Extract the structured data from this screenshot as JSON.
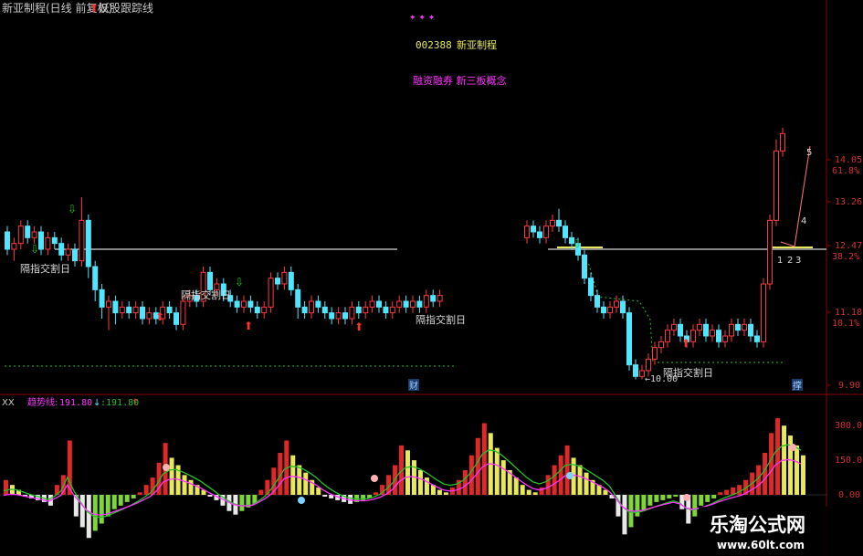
{
  "header": {
    "title": "新亚制程(日线 前复权)",
    "indicator": "妖股跟踪线",
    "stock_code": "002388",
    "stock_name": "新亚制程",
    "concepts": "融资融券 新三板概念",
    "stars": "✦ ✦ ✦"
  },
  "price_axis": {
    "labels": [
      "14.05",
      "61.8%",
      "13.26",
      "12.47",
      "38.2%",
      "11.18",
      "10.1%",
      "9.90"
    ]
  },
  "macd_axis": {
    "labels": [
      "300.0",
      "150.0",
      "0.00"
    ]
  },
  "lower_header": {
    "xx": "XX",
    "name": "趋势线:",
    "value1": "191.80",
    "value2": ":191.80"
  },
  "annotations": {
    "cross_label": "隔指交割日",
    "low_price": "10.00",
    "wave_labels": [
      "1",
      "2",
      "3",
      "4",
      "5"
    ],
    "fin_tag": "财",
    "jin_tag": "撑"
  },
  "watermark": {
    "line1": "乐淘公式网",
    "line2": "www.60lt.com"
  },
  "colors": {
    "up": "#ff3a3a",
    "down": "#4fe6ff",
    "ma": "#d8d8d8",
    "yellow": "#e8e85a",
    "green_dots": "#25c025",
    "magenta": "#ff33ff"
  },
  "chart_data": {
    "type": "candlestick",
    "price_range": [
      9.8,
      14.3
    ],
    "candles_segment1": [
      [
        12.5,
        12.2,
        12.6,
        12.1
      ],
      [
        12.2,
        12.3,
        12.4,
        12.0
      ],
      [
        12.3,
        12.6,
        12.7,
        12.2
      ],
      [
        12.6,
        12.4,
        12.7,
        12.3
      ],
      [
        12.4,
        12.5,
        12.6,
        12.3
      ],
      [
        12.5,
        12.2,
        12.6,
        12.1
      ],
      [
        12.2,
        12.4,
        12.5,
        12.1
      ],
      [
        12.4,
        12.3,
        12.5,
        12.2
      ],
      [
        12.3,
        12.1,
        12.4,
        12.0
      ],
      [
        12.1,
        12.2,
        12.3,
        12.0
      ],
      [
        12.2,
        12.0,
        12.3,
        11.9
      ],
      [
        12.0,
        12.7,
        13.1,
        11.9
      ],
      [
        12.7,
        11.9,
        12.8,
        11.7
      ],
      [
        11.9,
        11.5,
        12.0,
        11.3
      ],
      [
        11.5,
        11.2,
        11.6,
        11.0
      ],
      [
        11.2,
        11.3,
        11.4,
        10.8
      ],
      [
        11.3,
        11.1,
        11.4,
        10.9
      ],
      [
        11.1,
        11.2,
        11.3,
        11.0
      ],
      [
        11.2,
        11.1,
        11.3,
        11.0
      ],
      [
        11.1,
        11.2,
        11.3,
        11.0
      ],
      [
        11.2,
        11.0,
        11.3,
        10.9
      ],
      [
        11.0,
        11.1,
        11.2,
        10.9
      ],
      [
        11.1,
        11.0,
        11.2,
        10.9
      ],
      [
        11.0,
        11.2,
        11.3,
        10.9
      ],
      [
        11.2,
        11.1,
        11.3,
        11.0
      ],
      [
        11.1,
        10.9,
        11.2,
        10.8
      ],
      [
        10.9,
        11.3,
        11.4,
        10.8
      ],
      [
        11.3,
        11.4,
        11.5,
        11.2
      ],
      [
        11.4,
        11.3,
        11.5,
        11.2
      ],
      [
        11.3,
        11.8,
        11.9,
        11.2
      ],
      [
        11.8,
        11.5,
        11.9,
        11.4
      ],
      [
        11.5,
        11.6,
        11.7,
        11.4
      ],
      [
        11.6,
        11.4,
        11.7,
        11.3
      ],
      [
        11.4,
        11.3,
        11.5,
        11.2
      ],
      [
        11.3,
        11.2,
        11.4,
        11.1
      ],
      [
        11.2,
        11.3,
        11.4,
        11.1
      ],
      [
        11.3,
        11.2,
        11.4,
        11.1
      ],
      [
        11.2,
        11.1,
        11.3,
        11.0
      ],
      [
        11.1,
        11.2,
        11.3,
        11.0
      ],
      [
        11.2,
        11.7,
        11.8,
        11.1
      ],
      [
        11.7,
        11.6,
        11.8,
        11.5
      ],
      [
        11.6,
        11.8,
        11.9,
        11.5
      ],
      [
        11.8,
        11.5,
        11.9,
        11.4
      ],
      [
        11.5,
        11.2,
        11.6,
        11.0
      ],
      [
        11.2,
        11.1,
        11.3,
        11.0
      ],
      [
        11.1,
        11.3,
        11.4,
        11.0
      ],
      [
        11.3,
        11.2,
        11.4,
        11.1
      ],
      [
        11.2,
        11.1,
        11.3,
        11.0
      ],
      [
        11.1,
        11.0,
        11.2,
        10.9
      ],
      [
        11.0,
        11.1,
        11.2,
        10.9
      ],
      [
        11.1,
        11.0,
        11.2,
        10.9
      ],
      [
        11.0,
        11.2,
        11.3,
        10.9
      ],
      [
        11.2,
        11.1,
        11.3,
        11.0
      ],
      [
        11.1,
        11.2,
        11.3,
        11.0
      ],
      [
        11.2,
        11.3,
        11.4,
        11.1
      ],
      [
        11.3,
        11.2,
        11.4,
        11.1
      ],
      [
        11.2,
        11.1,
        11.3,
        11.0
      ],
      [
        11.1,
        11.2,
        11.3,
        11.0
      ],
      [
        11.2,
        11.3,
        11.4,
        11.1
      ],
      [
        11.3,
        11.2,
        11.4,
        11.1
      ],
      [
        11.2,
        11.3,
        11.4,
        11.1
      ],
      [
        11.3,
        11.2,
        11.4,
        11.1
      ],
      [
        11.2,
        11.4,
        11.5,
        11.1
      ],
      [
        11.4,
        11.3,
        11.5,
        11.2
      ],
      [
        11.3,
        11.4,
        11.5,
        11.2
      ]
    ],
    "candles_segment2": [
      [
        12.4,
        12.6,
        12.7,
        12.3
      ],
      [
        12.6,
        12.5,
        12.7,
        12.4
      ],
      [
        12.5,
        12.4,
        12.6,
        12.3
      ],
      [
        12.4,
        12.6,
        12.7,
        12.3
      ],
      [
        12.6,
        12.7,
        12.8,
        12.5
      ],
      [
        12.7,
        12.6,
        12.9,
        12.5
      ],
      [
        12.6,
        12.4,
        12.7,
        12.3
      ],
      [
        12.4,
        12.3,
        12.5,
        12.2
      ],
      [
        12.3,
        12.1,
        12.4,
        12.0
      ],
      [
        12.1,
        11.7,
        12.2,
        11.6
      ],
      [
        11.7,
        11.4,
        11.8,
        11.3
      ],
      [
        11.4,
        11.2,
        11.5,
        11.1
      ],
      [
        11.2,
        11.1,
        11.3,
        11.0
      ],
      [
        11.1,
        11.2,
        11.3,
        11.0
      ],
      [
        11.2,
        11.3,
        11.4,
        11.1
      ],
      [
        11.3,
        11.1,
        11.4,
        11.0
      ],
      [
        11.1,
        10.2,
        11.2,
        10.1
      ],
      [
        10.2,
        10.0,
        10.3,
        9.95
      ],
      [
        10.0,
        10.1,
        10.2,
        9.95
      ],
      [
        10.1,
        10.3,
        10.4,
        10.0
      ],
      [
        10.3,
        10.5,
        10.6,
        10.2
      ],
      [
        10.5,
        10.6,
        10.7,
        10.4
      ],
      [
        10.6,
        10.8,
        10.9,
        10.5
      ],
      [
        10.8,
        10.9,
        11.0,
        10.7
      ],
      [
        10.9,
        10.7,
        11.0,
        10.6
      ],
      [
        10.7,
        10.6,
        10.8,
        10.5
      ],
      [
        10.6,
        10.8,
        10.9,
        10.5
      ],
      [
        10.8,
        10.9,
        11.0,
        10.7
      ],
      [
        10.9,
        10.7,
        11.0,
        10.6
      ],
      [
        10.7,
        10.8,
        10.9,
        10.6
      ],
      [
        10.8,
        10.6,
        10.9,
        10.5
      ],
      [
        10.6,
        10.7,
        10.8,
        10.5
      ],
      [
        10.7,
        10.9,
        11.0,
        10.6
      ],
      [
        10.9,
        10.8,
        11.0,
        10.7
      ],
      [
        10.8,
        10.9,
        11.0,
        10.7
      ],
      [
        10.9,
        10.7,
        11.0,
        10.6
      ],
      [
        10.7,
        10.6,
        10.8,
        10.5
      ],
      [
        10.6,
        11.6,
        11.7,
        10.5
      ],
      [
        11.6,
        12.7,
        12.8,
        11.5
      ],
      [
        12.7,
        13.9,
        14.1,
        12.6
      ],
      [
        13.9,
        14.2,
        14.3,
        13.8
      ]
    ],
    "macd_histogram": [
      60,
      40,
      20,
      -10,
      -20,
      -30,
      -40,
      -60,
      40,
      80,
      220,
      -120,
      -180,
      -240,
      -200,
      -160,
      -120,
      -80,
      -60,
      -40,
      -20,
      10,
      40,
      70,
      130,
      210,
      150,
      120,
      80,
      60,
      40,
      20,
      -10,
      -30,
      -60,
      -90,
      -110,
      -90,
      -70,
      -50,
      20,
      60,
      110,
      170,
      220,
      160,
      120,
      90,
      60,
      30,
      -10,
      -20,
      -30,
      -40,
      -50,
      -40,
      -30,
      -20,
      10,
      40,
      80,
      120,
      200,
      180,
      140,
      100,
      70,
      40,
      20,
      10,
      30,
      60,
      100,
      160,
      230,
      290,
      250,
      190,
      140,
      100,
      70,
      40,
      20,
      10,
      30,
      80,
      120,
      160,
      200,
      150,
      120,
      90,
      60,
      40,
      20,
      -20,
      -120,
      -220,
      -180,
      -120,
      -90,
      -60,
      -40,
      -30,
      -20,
      -10,
      -80,
      -160,
      -120,
      -60,
      -40,
      -20,
      10,
      20,
      30,
      40,
      60,
      90,
      120,
      170,
      250,
      310,
      280,
      240,
      200,
      160
    ],
    "macd_range": [
      -320,
      340
    ]
  }
}
